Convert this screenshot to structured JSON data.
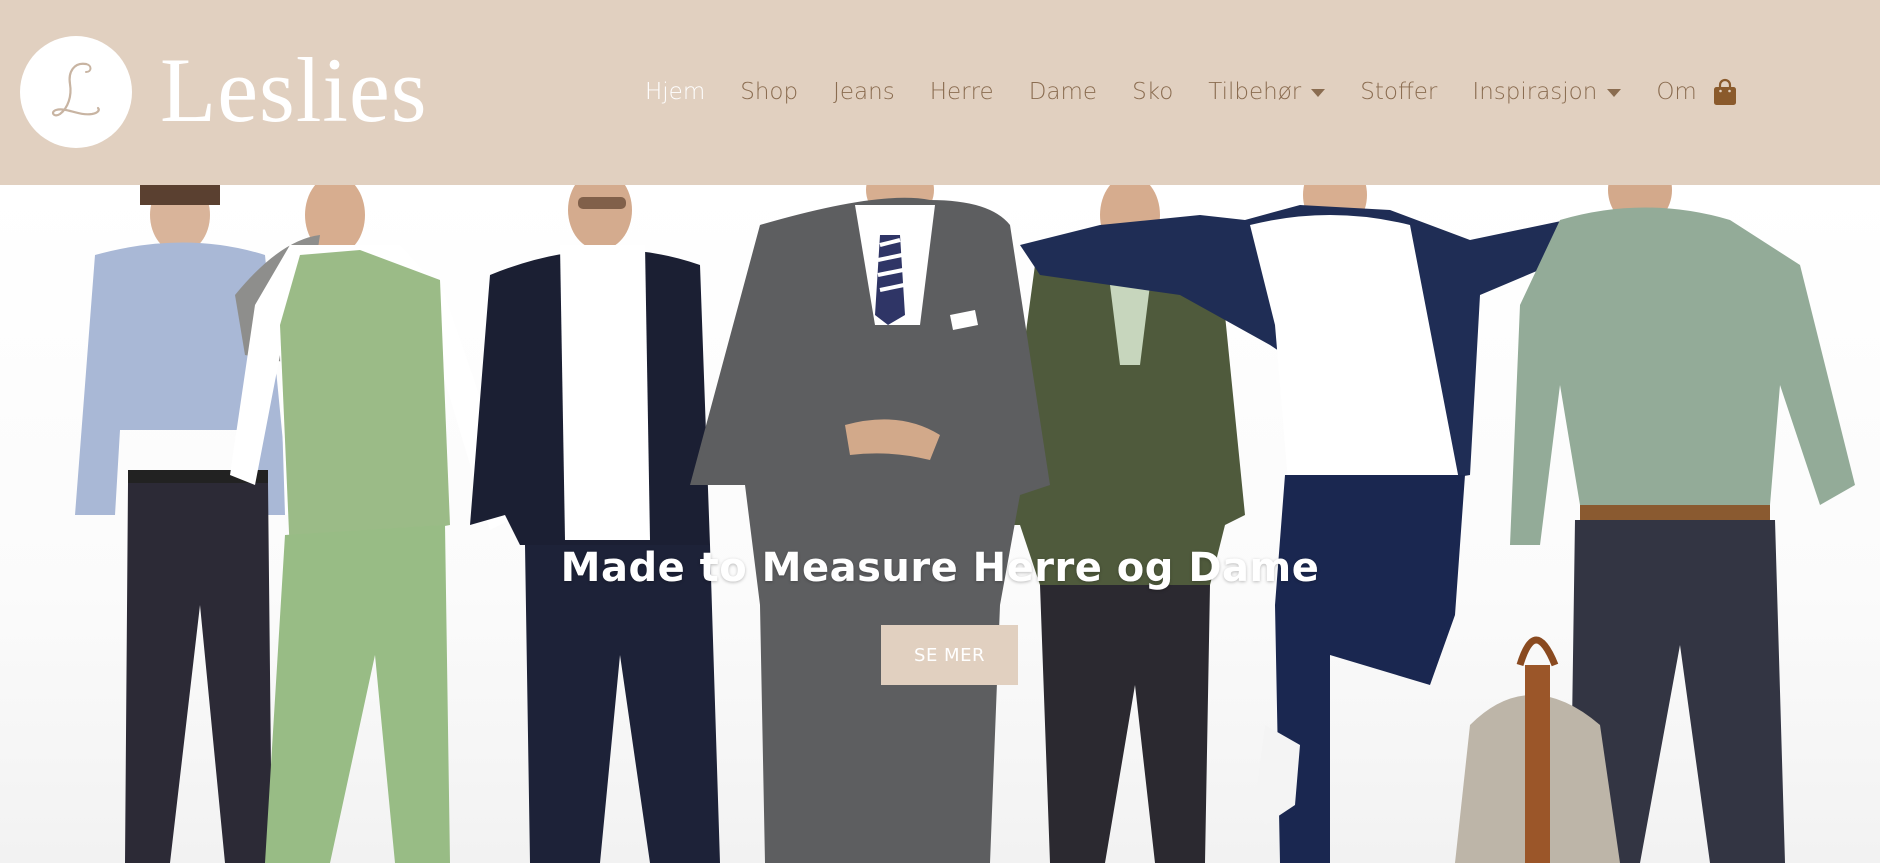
{
  "brand": {
    "name": "Leslies",
    "monogram": "L",
    "header_bg": "#e1d0c0",
    "accent_text": "#8a6c50"
  },
  "nav": {
    "items": [
      {
        "label": "Hjem",
        "active": true,
        "dropdown": false
      },
      {
        "label": "Shop",
        "active": false,
        "dropdown": false
      },
      {
        "label": "Jeans",
        "active": false,
        "dropdown": false
      },
      {
        "label": "Herre",
        "active": false,
        "dropdown": false
      },
      {
        "label": "Dame",
        "active": false,
        "dropdown": false
      },
      {
        "label": "Sko",
        "active": false,
        "dropdown": false
      },
      {
        "label": "Tilbehør",
        "active": false,
        "dropdown": true
      },
      {
        "label": "Stoffer",
        "active": false,
        "dropdown": false
      },
      {
        "label": "Inspirasjon",
        "active": false,
        "dropdown": true
      },
      {
        "label": "Om",
        "active": false,
        "dropdown": false
      }
    ],
    "cart_icon": "shopping-bag-icon"
  },
  "hero": {
    "title": "Made to Measure Herre og Dame",
    "button_label": "SE MER",
    "image": "models-in-suits-photo"
  }
}
